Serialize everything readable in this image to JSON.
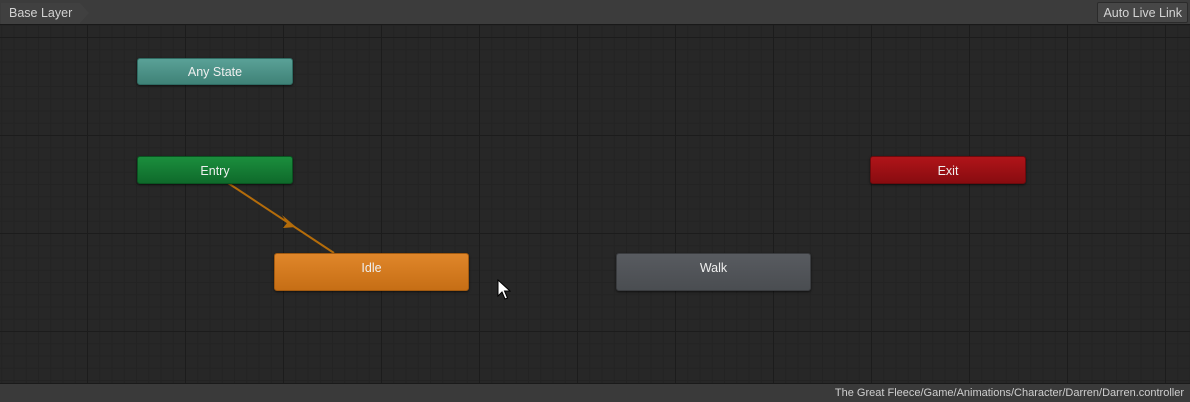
{
  "toolbar": {
    "breadcrumb": "Base Layer",
    "auto_live_link": "Auto Live Link"
  },
  "graph": {
    "nodes": {
      "any_state": "Any State",
      "entry": "Entry",
      "exit": "Exit",
      "idle": "Idle",
      "walk": "Walk"
    },
    "transitions": [
      {
        "from": "Entry",
        "to": "Idle"
      }
    ],
    "colors": {
      "any_state": "#4f9488",
      "entry": "#157a34",
      "exit": "#9e1015",
      "default_state": "#d97b1f",
      "state": "#52555a",
      "transition": "#b46c0a"
    }
  },
  "statusbar": {
    "path": "The Great Fleece/Game/Animations/Character/Darren/Darren.controller"
  },
  "cursor": "arrow-cursor-icon"
}
